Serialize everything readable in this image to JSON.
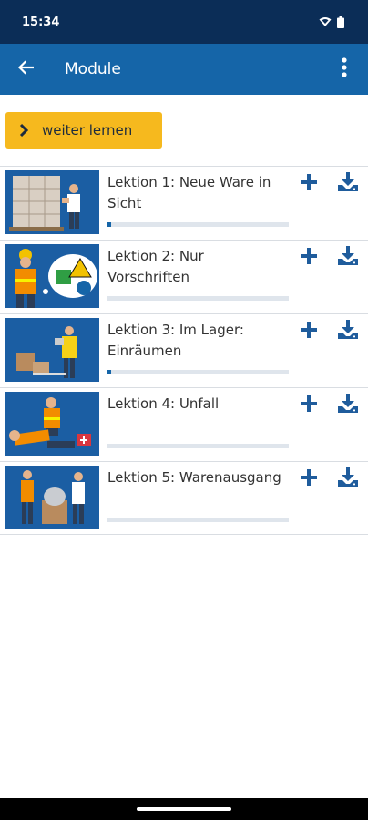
{
  "status_bar": {
    "time": "15:34",
    "wifi_icon": "wifi-icon",
    "battery_icon": "battery-icon"
  },
  "app_bar": {
    "title": "Module",
    "back_icon": "arrow-back-icon",
    "menu_icon": "more-vert-icon"
  },
  "continue_button": {
    "label": "weiter lernen",
    "icon": "chevron-right-icon"
  },
  "lessons": [
    {
      "title": "Lektion 1: Neue Ware in Sicht",
      "progress": 0.02,
      "thumb": "warehouse-worker-boxes"
    },
    {
      "title": "Lektion 2: Nur Vorschriften",
      "progress": 0,
      "thumb": "worker-safety-signs"
    },
    {
      "title": "Lektion 3: Im Lager: Einräumen",
      "progress": 0.02,
      "thumb": "worker-storing-boxes"
    },
    {
      "title": "Lektion 4: Unfall",
      "progress": 0,
      "thumb": "first-aid-accident"
    },
    {
      "title": "Lektion 5: Warenausgang",
      "progress": 0,
      "thumb": "goods-dispatch"
    }
  ],
  "icons": {
    "add": "plus-icon",
    "download": "download-icon"
  },
  "colors": {
    "status_bar": "#0b2d57",
    "app_bar": "#1565a8",
    "accent": "#f6b91e",
    "icon_blue": "#1f5c9c",
    "progress_track": "#dfe5ec"
  }
}
